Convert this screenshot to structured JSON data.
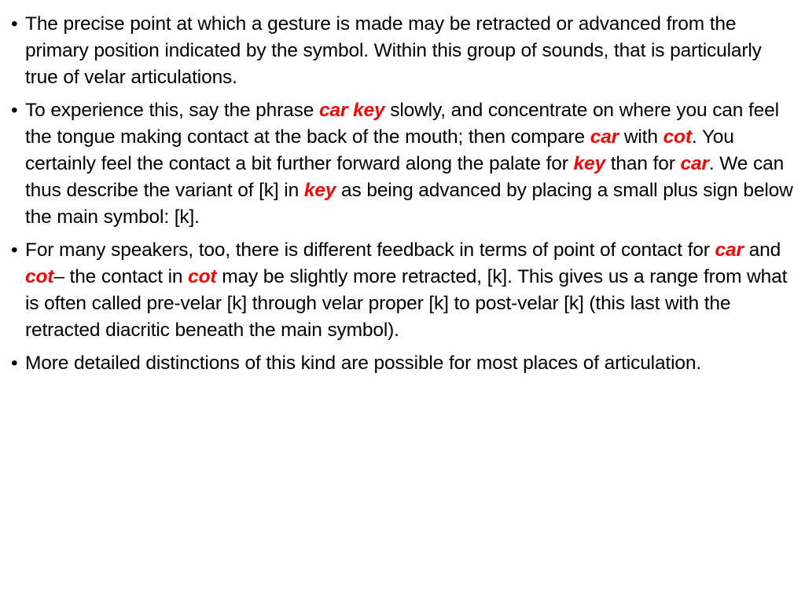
{
  "slide": {
    "background_color": "#FFFFFF",
    "text_color": "#000000",
    "highlight_color": "#FF0000",
    "bullet_marker": "•"
  },
  "bullets": [
    {
      "id": "bullet-1",
      "plain_text": "The precise point at which a gesture is made may be retracted or advanced from the primary position indicated by the symbol. Within this group of sounds, that is particularly true of velar articulations.",
      "segments": [
        {
          "text": "The precise point at which a gesture is made may be retracted or advanced from the primary position indicated by the symbol. Within this group of sounds, that is particularly true of velar articulations.",
          "style": "normal"
        }
      ]
    },
    {
      "id": "bullet-2",
      "plain_text": "To experience this, say the phrase car key slowly, and concentrate on where you can feel the tongue making contact at the back of the mouth; then compare car with cot. You certainly feel the contact a bit further forward along the palate for key than for car. We can thus describe the variant of [k] in key as being advanced by placing a small plus sign below the main symbol: [k].",
      "segments": [
        {
          "text": "To experience this, say the phrase ",
          "style": "normal"
        },
        {
          "text": "car key",
          "style": "highlight"
        },
        {
          "text": " slowly, and concentrate on where you can feel the tongue making contact at the back of the mouth; then compare ",
          "style": "normal"
        },
        {
          "text": "car",
          "style": "highlight"
        },
        {
          "text": " with ",
          "style": "normal"
        },
        {
          "text": "cot",
          "style": "highlight"
        },
        {
          "text": ". You certainly feel the contact a bit further forward along the palate for ",
          "style": "normal"
        },
        {
          "text": "key",
          "style": "highlight"
        },
        {
          "text": " than for ",
          "style": "normal"
        },
        {
          "text": "car",
          "style": "highlight"
        },
        {
          "text": ". We can thus describe the variant of [k] in ",
          "style": "normal"
        },
        {
          "text": "key",
          "style": "highlight"
        },
        {
          "text": " as being advanced by placing a small plus sign below the main symbol: [k].",
          "style": "normal"
        }
      ]
    },
    {
      "id": "bullet-3",
      "plain_text": "For many speakers, too, there is different feedback in terms of point of contact for car and cot– the contact in cot may be slightly more retracted, [k]. This gives us a range from what is often called pre-velar [k] through velar proper [k] to post-velar [k] (this last with the retracted diacritic beneath the main symbol).",
      "segments": [
        {
          "text": "For many speakers, too, there is different feedback in terms of point of contact for ",
          "style": "normal"
        },
        {
          "text": "car",
          "style": "highlight"
        },
        {
          "text": " and ",
          "style": "normal"
        },
        {
          "text": "cot",
          "style": "highlight"
        },
        {
          "text": "– the contact in ",
          "style": "normal"
        },
        {
          "text": "cot",
          "style": "highlight"
        },
        {
          "text": " may be slightly more retracted, [k]. This gives us a range from what is often called pre-velar [k] through velar proper [k] to post-velar [k] (this last with the retracted diacritic beneath the main symbol).",
          "style": "normal"
        }
      ]
    },
    {
      "id": "bullet-4",
      "plain_text": "More detailed distinctions of this kind are possible for most places of articulation.",
      "segments": [
        {
          "text": "More detailed distinctions of this kind are possible for most places of articulation.",
          "style": "normal"
        }
      ]
    }
  ]
}
